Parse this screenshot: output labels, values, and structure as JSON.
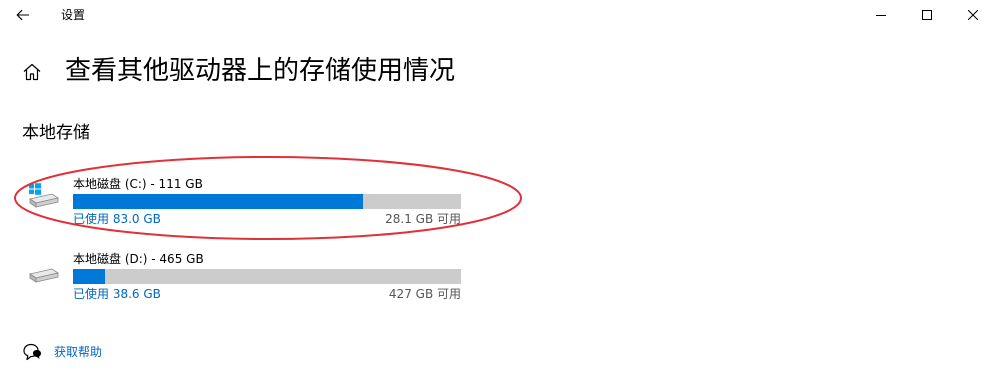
{
  "window": {
    "title": "设置",
    "back_icon": "back-arrow-icon",
    "controls": [
      "minimize-icon",
      "maximize-icon",
      "close-icon"
    ]
  },
  "page": {
    "title": "查看其他驱动器上的存储使用情况",
    "home_icon": "home-icon"
  },
  "section": {
    "title": "本地存储"
  },
  "drives": [
    {
      "name": "本地磁盘 (C:) - 111 GB",
      "used_label": "已使用 83.0 GB",
      "free_label": "28.1 GB 可用",
      "used_fraction": 0.748,
      "icon": "system-drive-icon",
      "highlighted": true
    },
    {
      "name": "本地磁盘 (D:) - 465 GB",
      "used_label": "已使用 38.6 GB",
      "free_label": "427 GB 可用",
      "used_fraction": 0.083,
      "icon": "drive-icon",
      "highlighted": false
    }
  ],
  "help": {
    "label": "获取帮助",
    "icon": "help-chat-icon"
  },
  "colors": {
    "accent": "#0078d7",
    "link": "#0067c0",
    "bar_track": "#cccccc",
    "highlight": "#e0303a"
  }
}
